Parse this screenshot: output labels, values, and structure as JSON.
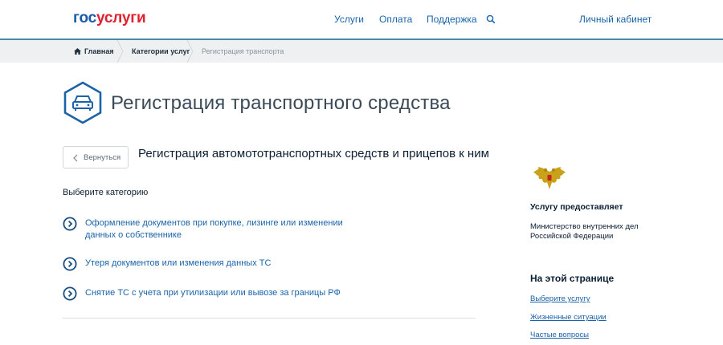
{
  "header": {
    "logo_gos": "гос",
    "logo_uslugi": "услуги",
    "nav": [
      "Услуги",
      "Оплата",
      "Поддержка"
    ],
    "account": "Личный кабинет",
    "search_icon": "search-icon"
  },
  "breadcrumb": {
    "items": [
      "Главная",
      "Категории услуг",
      "Регистрация транспорта"
    ]
  },
  "page": {
    "title": "Регистрация транспортного средства",
    "back_label": "Вернуться",
    "subtitle": "Регистрация автомототранспортных средств и прицепов к ним",
    "choose_label": "Выберите категорию",
    "options": [
      "Оформление документов при покупке, лизинге или изменении данных о собственнике",
      "Утеря документов или изменения данных ТС",
      "Снятие ТС с учета при утилизации или вывозе за границы РФ"
    ]
  },
  "sidebar": {
    "provider_title": "Услугу предоставляет",
    "provider_name": "Министерство внутренних дел Российской Федерации",
    "toc_title": "На этой странице",
    "toc_links": [
      "Выберите услугу",
      "Жизненные ситуации",
      "Частые вопросы"
    ]
  },
  "colors": {
    "brand_blue": "#1a5ba8",
    "brand_red": "#e3212e",
    "link": "#1a63a8",
    "accent_line": "#4a8aa8"
  }
}
